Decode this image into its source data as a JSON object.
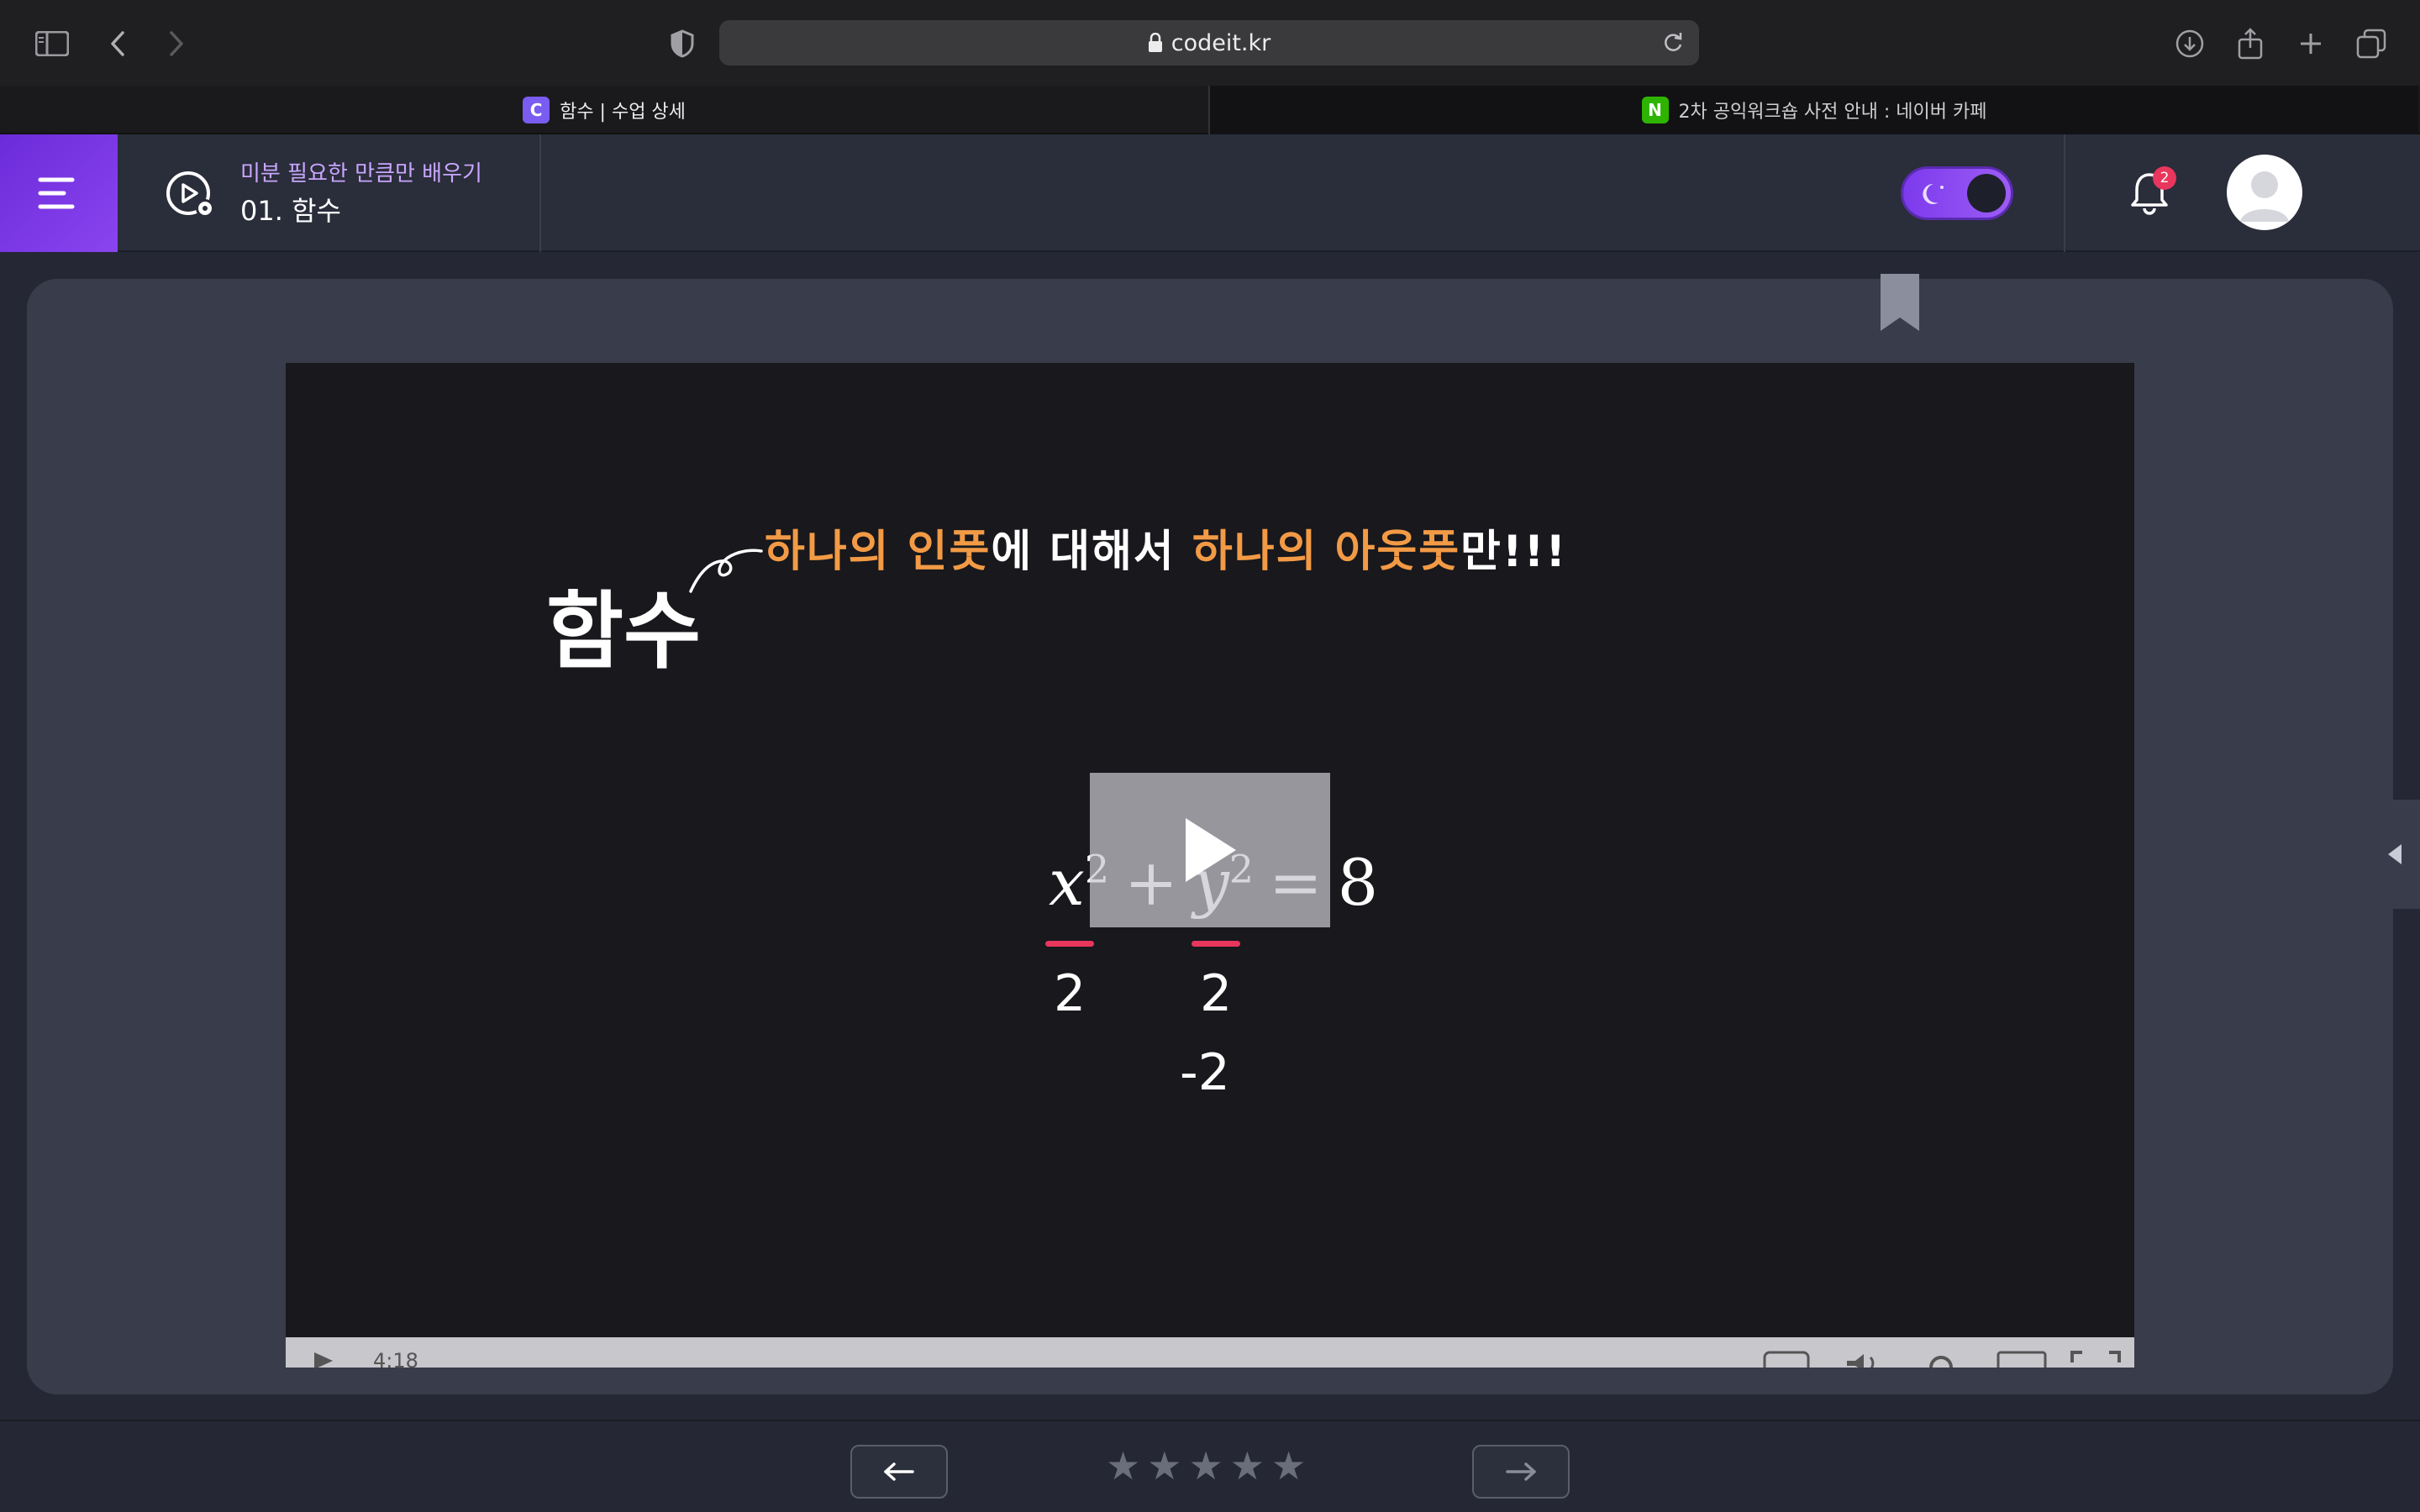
{
  "browser": {
    "url": "codeit.kr",
    "tabs": [
      {
        "label": "함수 | 수업 상세",
        "favicon": "C",
        "active": true
      },
      {
        "label": "2차 공익워크숍 사전 안내 : 네이버 카페",
        "favicon": "N",
        "active": false
      }
    ]
  },
  "header": {
    "course_name": "미분 필요한 만큼만 배우기",
    "lesson_name": "01. 함수",
    "notification_count": "2",
    "theme": "dark"
  },
  "slide": {
    "title": "함수",
    "definition": {
      "part1": "하나의 인풋",
      "part2": "에 대해서 ",
      "part3": "하나의 아웃풋",
      "part4": "만!!!"
    },
    "equation": {
      "x": "x",
      "y": "y",
      "exp": "2",
      "plus": "+",
      "equals": "=",
      "rhs": "8"
    },
    "values": {
      "x_value": "2",
      "y_value_1": "2",
      "y_value_2": "-2"
    }
  },
  "player": {
    "time": "4:18"
  },
  "rating": {
    "stars": 5,
    "filled": 0
  },
  "colors": {
    "accent_purple": "#7c3aed",
    "highlight_orange": "#f29a45",
    "underline_red": "#e8365d"
  }
}
